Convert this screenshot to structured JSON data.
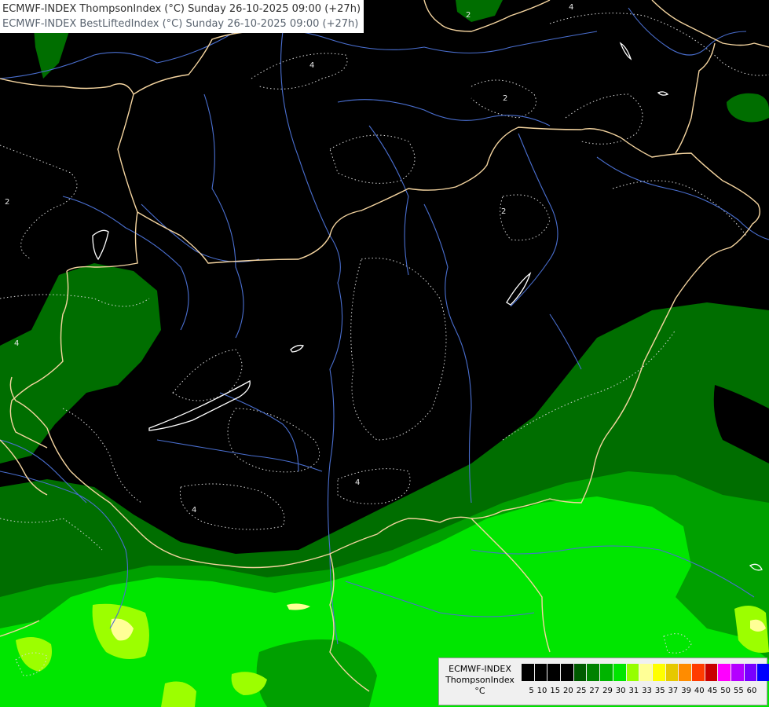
{
  "title": {
    "line1": "ECMWF-INDEX ThompsonIndex (°C) Sunday 26-10-2025 09:00 (+27h)",
    "line2": "ECMWF-INDEX BestLiftedIndex (°C) Sunday 26-10-2025 09:00 (+27h)"
  },
  "legend": {
    "source": "ECMWF-INDEX",
    "parameter": "ThompsonIndex",
    "unit": "°C",
    "labels": [
      "5",
      "10",
      "15",
      "20",
      "25",
      "27",
      "29",
      "30",
      "31",
      "33",
      "35",
      "37",
      "39",
      "40",
      "45",
      "50",
      "55",
      "60"
    ],
    "colors": [
      "#000000",
      "#000000",
      "#000000",
      "#000000",
      "#005a00",
      "#008200",
      "#00b400",
      "#00e600",
      "#96ff00",
      "#ffff96",
      "#ffff00",
      "#e6c800",
      "#ff8c00",
      "#ff3c00",
      "#c80000",
      "#ff00ff",
      "#b400ff",
      "#7800ff",
      "#0000ff"
    ]
  },
  "contour_labels": [
    "4",
    "2",
    "2",
    "2",
    "4",
    "4",
    "4",
    "4",
    "2"
  ],
  "colors": {
    "background": "#000000",
    "dark_green": "#006e00",
    "mid_green": "#00a000",
    "bright_green": "#00e600",
    "lime": "#9cff00",
    "yellow": "#ffff96",
    "border": "#f5d5a0",
    "river": "#4a6fd0",
    "contour": "#d8d8d8"
  }
}
